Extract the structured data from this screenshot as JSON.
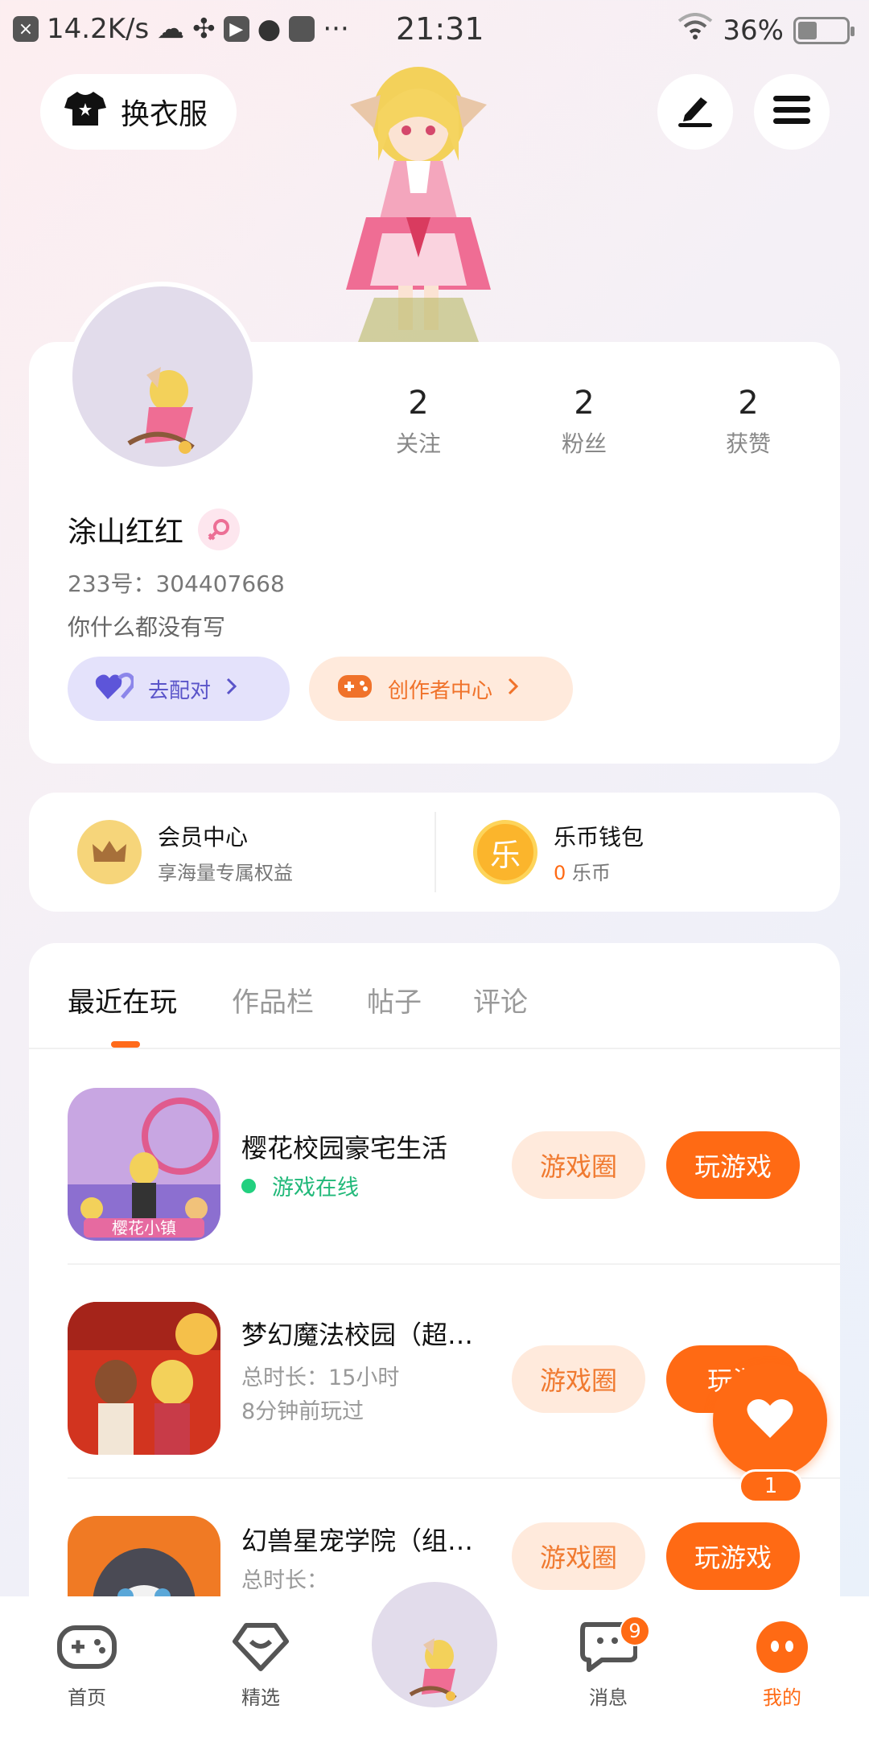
{
  "status_bar": {
    "speed": "14.2K/s",
    "time": "21:31",
    "battery": "36%",
    "more": "···"
  },
  "header": {
    "change_clothes_label": "换衣服"
  },
  "profile": {
    "stats": [
      {
        "value": "2",
        "label": "关注"
      },
      {
        "value": "2",
        "label": "粉丝"
      },
      {
        "value": "2",
        "label": "获赞"
      }
    ],
    "username": "涂山红红",
    "uid": "233号：304407668",
    "bio": "你什么都没有写",
    "pair_button": "去配对",
    "creator_button": "创作者中心"
  },
  "wallet": {
    "vip_title": "会员中心",
    "vip_sub": "享海量专属权益",
    "coin_title": "乐币钱包",
    "coin_amount": "0",
    "coin_unit": "乐币",
    "coin_glyph": "乐"
  },
  "tabs": [
    "最近在玩",
    "作品栏",
    "帖子",
    "评论"
  ],
  "games": [
    {
      "title": "樱花校园豪宅生活",
      "status": "游戏在线",
      "icon_label": "樱花小镇"
    },
    {
      "title": "梦幻魔法校园（超…",
      "duration": "总时长：15小时",
      "last_played": "8分钟前玩过"
    },
    {
      "title": "幻兽星宠学院（组…",
      "duration": "总时长：",
      "last_played": ""
    }
  ],
  "buttons": {
    "circle": "游戏圈",
    "play": "玩游戏",
    "play_partial": "玩游"
  },
  "fab_count": "1",
  "bottom_nav": {
    "home": "首页",
    "featured": "精选",
    "messages": "消息",
    "messages_badge": "9",
    "mine": "我的"
  },
  "colors": {
    "accent": "#ff6a14",
    "pair_purple": "#5a54c9",
    "online_green": "#22b97a"
  }
}
